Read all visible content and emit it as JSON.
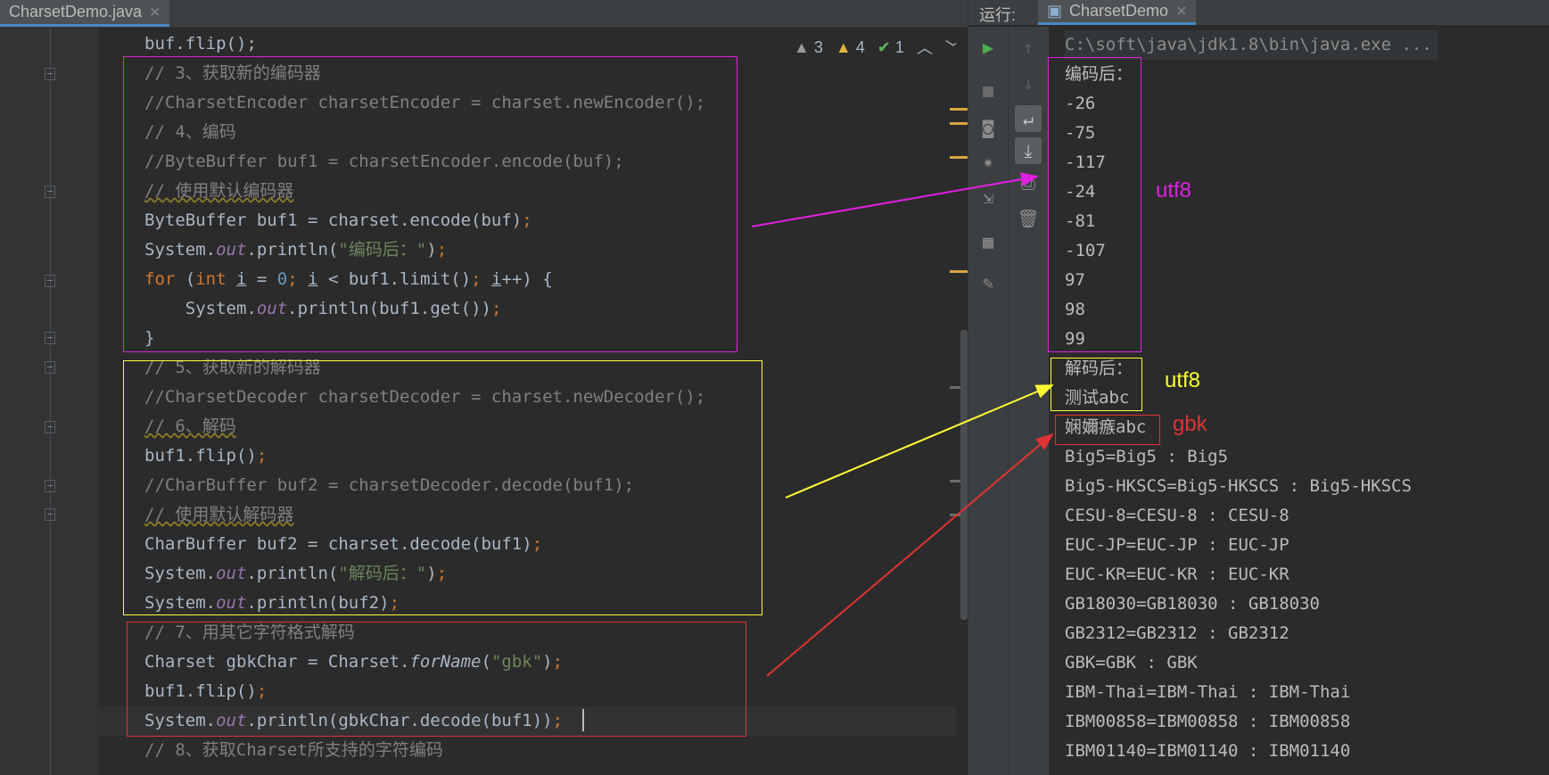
{
  "editor": {
    "file_tab": "CharsetDemo.java",
    "inspections": {
      "warnings_a": "3",
      "warnings_b": "4",
      "ok": "1"
    },
    "lines": [
      {
        "parts": [
          [
            "",
            "buf.flip();"
          ]
        ]
      },
      {
        "parts": [
          [
            "cm",
            "// 3、获取新的编码器"
          ]
        ]
      },
      {
        "parts": [
          [
            "cm",
            "//CharsetEncoder charsetEncoder = charset.newEncoder();"
          ]
        ]
      },
      {
        "parts": [
          [
            "cm",
            "// 4、编码"
          ]
        ]
      },
      {
        "parts": [
          [
            "cm",
            "//ByteBuffer buf1 = charsetEncoder.encode(buf);"
          ]
        ]
      },
      {
        "parts": [
          [
            "cm wavy",
            "// 使用默认编码器"
          ]
        ]
      },
      {
        "parts": [
          [
            "",
            "ByteBuffer buf1 = charset.encode(buf)"
          ],
          [
            "kw",
            ";"
          ]
        ]
      },
      {
        "parts": [
          [
            "",
            "System."
          ],
          [
            "fld",
            "out"
          ],
          [
            "",
            ".println("
          ],
          [
            "str",
            "\"编码后：\""
          ],
          [
            "",
            ")"
          ],
          [
            "kw",
            ";"
          ]
        ]
      },
      {
        "parts": [
          [
            "kw",
            "for "
          ],
          [
            "",
            "("
          ],
          [
            "kw",
            "int "
          ],
          [
            "und",
            "i"
          ],
          [
            "",
            " = "
          ],
          [
            "num",
            "0"
          ],
          [
            "kw",
            "; "
          ],
          [
            "und",
            "i"
          ],
          [
            "",
            " < buf1.limit()"
          ],
          [
            "kw",
            "; "
          ],
          [
            "und",
            "i"
          ],
          [
            "",
            "++) {"
          ]
        ]
      },
      {
        "parts": [
          [
            "",
            "    System."
          ],
          [
            "fld",
            "out"
          ],
          [
            "",
            ".println(buf1.get())"
          ],
          [
            "kw",
            ";"
          ]
        ]
      },
      {
        "parts": [
          [
            "",
            "}"
          ]
        ]
      },
      {
        "parts": [
          [
            "cm",
            "// 5、获取新的解码器"
          ]
        ]
      },
      {
        "parts": [
          [
            "cm",
            "//CharsetDecoder charsetDecoder = charset.newDecoder();"
          ]
        ]
      },
      {
        "parts": [
          [
            "cm wavy",
            "// 6、解码"
          ]
        ]
      },
      {
        "parts": [
          [
            "",
            "buf1.flip()"
          ],
          [
            "kw",
            ";"
          ]
        ]
      },
      {
        "parts": [
          [
            "cm",
            "//CharBuffer buf2 = charsetDecoder.decode(buf1);"
          ]
        ]
      },
      {
        "parts": [
          [
            "cm wavy",
            "// 使用默认解码器"
          ]
        ]
      },
      {
        "parts": [
          [
            "",
            "CharBuffer buf2 = charset.decode(buf1)"
          ],
          [
            "kw",
            ";"
          ]
        ]
      },
      {
        "parts": [
          [
            "",
            "System."
          ],
          [
            "fld",
            "out"
          ],
          [
            "",
            ".println("
          ],
          [
            "str",
            "\"解码后：\""
          ],
          [
            "",
            ")"
          ],
          [
            "kw",
            ";"
          ]
        ]
      },
      {
        "parts": [
          [
            "",
            "System."
          ],
          [
            "fld",
            "out"
          ],
          [
            "",
            ".println(buf2)"
          ],
          [
            "kw",
            ";"
          ]
        ]
      },
      {
        "parts": [
          [
            "cm",
            "// 7、用其它字符格式解码"
          ]
        ]
      },
      {
        "parts": [
          [
            "",
            "Charset gbkChar = Charset."
          ],
          [
            "fn",
            "forName"
          ],
          [
            "",
            "("
          ],
          [
            "str",
            "\"gbk\""
          ],
          [
            "",
            ")"
          ],
          [
            "kw",
            ";"
          ]
        ]
      },
      {
        "parts": [
          [
            "",
            "buf1.flip()"
          ],
          [
            "kw",
            ";"
          ]
        ]
      },
      {
        "parts": [
          [
            "",
            "System."
          ],
          [
            "fld",
            "out"
          ],
          [
            "",
            ".println(gbkChar.decode(buf1))"
          ],
          [
            "kw",
            ";"
          ]
        ]
      },
      {
        "parts": [
          [
            "cm",
            "// 8、获取Charset所支持的字符编码"
          ]
        ]
      }
    ]
  },
  "run": {
    "label": "运行:",
    "tab": "CharsetDemo",
    "command": "C:\\soft\\java\\jdk1.8\\bin\\java.exe ...",
    "output": [
      "编码后：",
      "-26",
      "-75",
      "-117",
      "-24",
      "-81",
      "-107",
      "97",
      "98",
      "99",
      "解码后：",
      "测试abc",
      "娴嬭瘯abc",
      "Big5=Big5 : Big5",
      "Big5-HKSCS=Big5-HKSCS : Big5-HKSCS",
      "CESU-8=CESU-8 : CESU-8",
      "EUC-JP=EUC-JP : EUC-JP",
      "EUC-KR=EUC-KR : EUC-KR",
      "GB18030=GB18030 : GB18030",
      "GB2312=GB2312 : GB2312",
      "GBK=GBK : GBK",
      "IBM-Thai=IBM-Thai : IBM-Thai",
      "IBM00858=IBM00858 : IBM00858",
      "IBM01140=IBM01140 : IBM01140"
    ]
  },
  "annotations": {
    "encode_label": "utf8",
    "decode_label": "utf8",
    "gbk_label": "gbk",
    "colors": {
      "magenta": "#e020e0",
      "yellow": "#ffff33",
      "red": "#e03333"
    }
  }
}
